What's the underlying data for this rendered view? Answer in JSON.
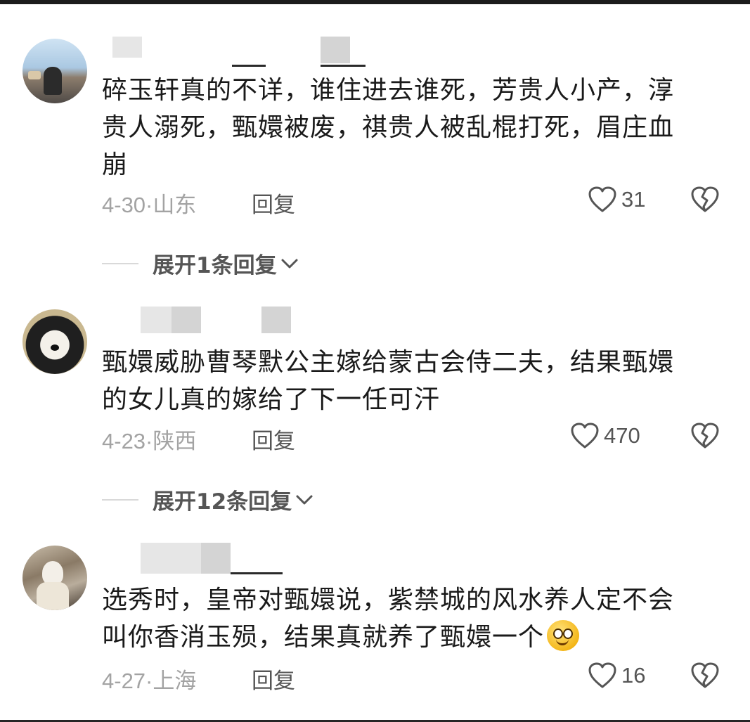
{
  "comments": [
    {
      "text_line1": "碎玉轩真的不详，谁住进去谁死，芳贵人小产，淳",
      "text_line2": "贵人溺死，甄嬛被废，祺贵人被乱棍打死，眉庄血",
      "text_line3": "崩",
      "date": "4-30",
      "location": "山东",
      "reply_label": "回复",
      "likes": "31",
      "expand_label": "展开1条回复"
    },
    {
      "text_line1": "甄嬛威胁曹琴默公主嫁给蒙古会侍二夫，结果甄嬛",
      "text_line2": "的女儿真的嫁给了下一任可汗",
      "date": "4-23",
      "location": "陕西",
      "reply_label": "回复",
      "likes": "470",
      "expand_label": "展开12条回复"
    },
    {
      "text_line1": "选秀时，皇帝对甄嬛说，紫禁城的风水养人定不会",
      "text_line2": "叫你香消玉殒，结果真就养了甄嬛一个",
      "date": "4-27",
      "location": "上海",
      "reply_label": "回复",
      "likes": "16"
    }
  ],
  "icons": {
    "like": "heart-outline-icon",
    "dislike": "broken-heart-icon",
    "expand": "chevron-down-icon",
    "emoji": "smiling-face-emoji"
  },
  "colors": {
    "text": "#1a1a1a",
    "meta": "#a3a3a3",
    "secondary": "#555555"
  }
}
